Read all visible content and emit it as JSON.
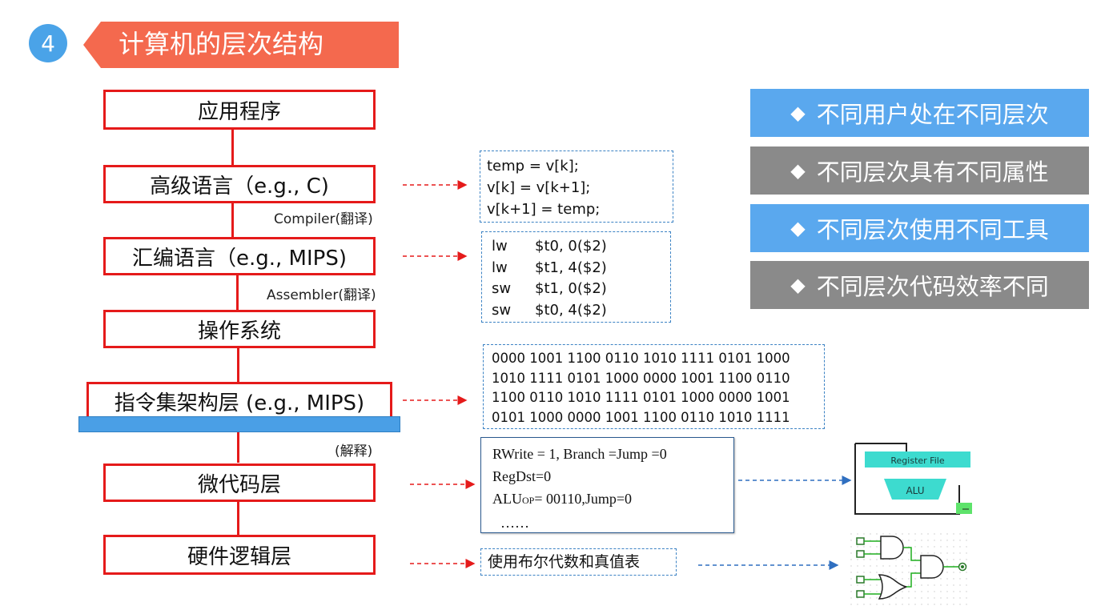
{
  "header": {
    "number": "4",
    "title": "计算机的层次结构"
  },
  "layers": [
    {
      "label": "应用程序"
    },
    {
      "label": "高级语言（e.g., C)"
    },
    {
      "label": "汇编语言（e.g., MIPS)"
    },
    {
      "label": "操作系统"
    },
    {
      "label": "指令集架构层 (e.g., MIPS)"
    },
    {
      "label": "微代码层"
    },
    {
      "label": "硬件逻辑层"
    }
  ],
  "notes": {
    "compiler": "Compiler(翻译)",
    "assembler": "Assembler(翻译)",
    "interpret": "(解释)"
  },
  "c_code": [
    "temp = v[k];",
    "v[k] = v[k+1];",
    "v[k+1] = temp;"
  ],
  "asm_code": [
    {
      "op": "lw",
      "args": "$t0, 0($2)"
    },
    {
      "op": "lw",
      "args": "$t1, 4($2)"
    },
    {
      "op": "sw",
      "args": "$t1, 0($2)"
    },
    {
      "op": "sw",
      "args": "$t0, 4($2)"
    }
  ],
  "machine_code": [
    "0000 1001 1100 0110 1010 1111 0101 1000",
    "1010 1111 0101 1000 0000 1001 1100 0110",
    "1100 0110 1010 1111 0101 1000 0000 1001",
    "0101 1000 0000 1001 1100 0110 1010 1111"
  ],
  "microcode": {
    "line1": "RWrite = 1, Branch =Jump =0",
    "line2": "RegDst=0",
    "line3_prefix": "ALU",
    "line3_sub": "OP",
    "line3_suffix": "= 00110,Jump=0",
    "line4": "……"
  },
  "hardware_note": "使用布尔代数和真值表",
  "illustration": {
    "register_file": "Register File",
    "alu": "ALU"
  },
  "bullets": [
    {
      "text": "不同用户处在不同层次",
      "color": "#5aa8ee"
    },
    {
      "text": "不同层次具有不同属性",
      "color": "#8a8a8a"
    },
    {
      "text": "不同层次使用不同工具",
      "color": "#5aa8ee"
    },
    {
      "text": "不同层次代码效率不同",
      "color": "#8a8a8a"
    }
  ],
  "bullet_symbol": "◆",
  "colors": {
    "accent_red": "#e51a1a",
    "title_banner": "#f4694e",
    "number_circle": "#4aa3e8",
    "dashed_blue": "#3b82c4"
  }
}
